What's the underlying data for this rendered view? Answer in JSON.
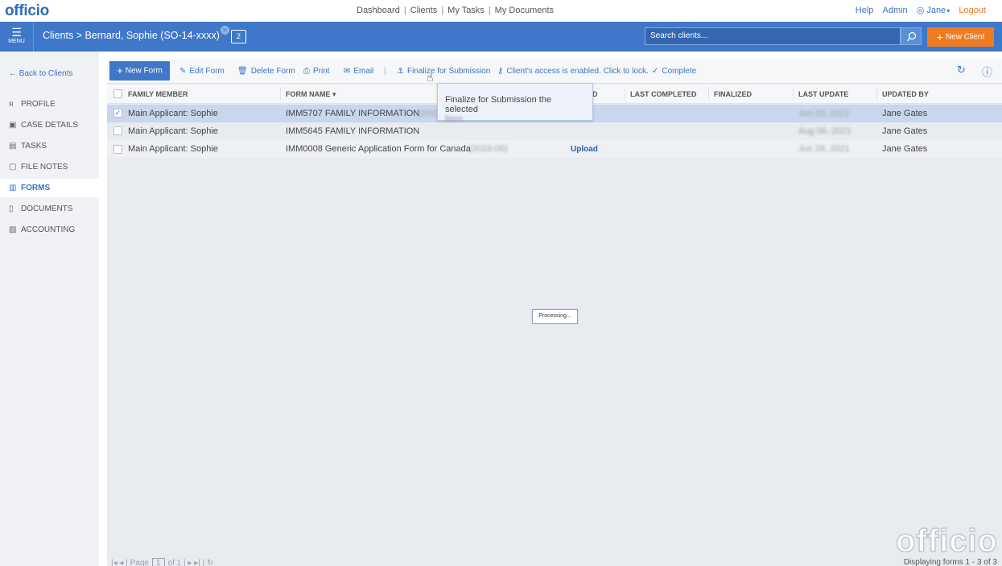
{
  "brand": {
    "logo": "officio",
    "watermark": "officio"
  },
  "top_nav": {
    "links": [
      "Dashboard",
      "Clients",
      "My Tasks",
      "My Documents"
    ],
    "help": "Help",
    "admin": "Admin",
    "user": "Jane",
    "logout": "Logout"
  },
  "header": {
    "menu_label": "MENU",
    "breadcrumb_root": "Clients",
    "breadcrumb_client": "Bernard, Sophie (SO-14-xxxx)",
    "calendar_badge": "2",
    "search_placeholder": "Search clients...",
    "new_client": "New Client"
  },
  "sidebar": {
    "back": "Back to Clients",
    "items": [
      {
        "label": "PROFILE",
        "icon": "user-icon",
        "active": false
      },
      {
        "label": "CASE DETAILS",
        "icon": "id-card-icon",
        "active": false
      },
      {
        "label": "TASKS",
        "icon": "clipboard-icon",
        "active": false
      },
      {
        "label": "FILE NOTES",
        "icon": "note-icon",
        "active": false
      },
      {
        "label": "FORMS",
        "icon": "form-icon",
        "active": true
      },
      {
        "label": "DOCUMENTS",
        "icon": "document-icon",
        "active": false
      },
      {
        "label": "ACCOUNTING",
        "icon": "money-icon",
        "active": false
      }
    ]
  },
  "toolbar": {
    "new_form": "New Form",
    "edit_form": "Edit Form",
    "delete_form": "Delete Form",
    "print": "Print",
    "email": "Email",
    "finalize": "Finalize for Submission",
    "access": "Client's access is enabled. Click to lock.",
    "complete": "Complete"
  },
  "table": {
    "columns": [
      "FAMILY MEMBER",
      "FORM NAME",
      "D",
      "LAST COMPLETED",
      "FINALIZED",
      "LAST UPDATE",
      "UPDATED BY"
    ],
    "rows": [
      {
        "member": "Main Applicant: Sophie",
        "form": "IMM5707 FAMILY INFORMATION",
        "form_suffix": "(2019",
        "status": "",
        "last_update": "Jun 25, 2021",
        "updated_by": "Jane Gates",
        "selected": true
      },
      {
        "member": "Main Applicant: Sophie",
        "form": "IMM5645 FAMILY INFORMATION",
        "form_suffix": "",
        "status": "",
        "last_update": "Aug 06, 2021",
        "updated_by": "Jane Gates",
        "selected": false
      },
      {
        "member": "Main Applicant: Sophie",
        "form": "IMM0008 Generic Application Form for Canada",
        "form_suffix": "(2019-06)",
        "status": "Upload",
        "last_update": "Jun 28, 2021",
        "updated_by": "Jane Gates",
        "selected": false
      }
    ]
  },
  "tooltip": {
    "line1": "Finalize for Submission the selected",
    "line2": "form"
  },
  "processing": "Processing...",
  "pager": {
    "page_label": "Page",
    "page": "1",
    "of": "of 1",
    "display": "Displaying forms 1 - 3 of 3"
  },
  "colors": {
    "primary": "#3f78c8",
    "accent": "#f07c22",
    "link": "#3b74c6"
  }
}
